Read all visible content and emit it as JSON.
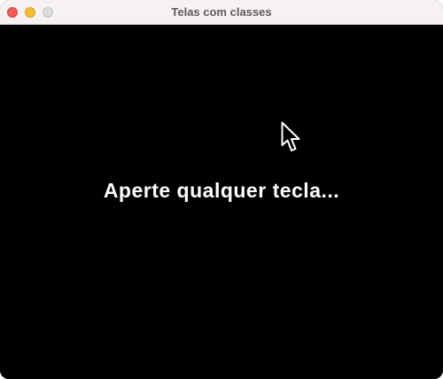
{
  "window": {
    "title": "Telas com classes"
  },
  "content": {
    "message": "Aperte qualquer tecla...",
    "background_color": "#000000",
    "text_color": "#ffffff"
  },
  "cursor": {
    "icon": "arrow-pointer-icon"
  }
}
